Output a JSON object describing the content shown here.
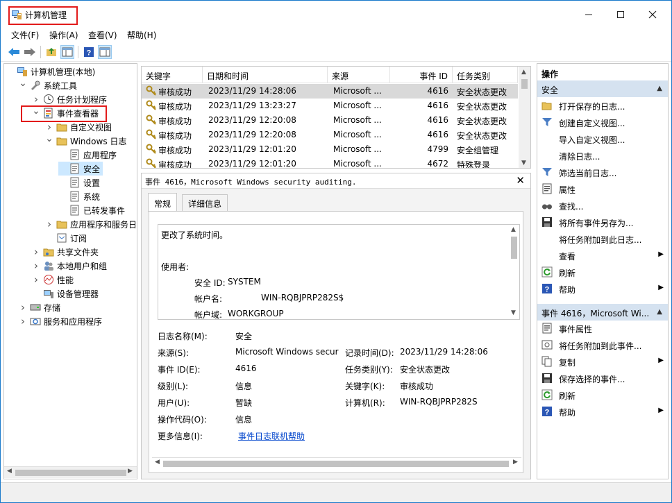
{
  "window": {
    "title": "计算机管理"
  },
  "menu": [
    "文件(F)",
    "操作(A)",
    "查看(V)",
    "帮助(H)"
  ],
  "tree": [
    {
      "label": "计算机管理(本地)",
      "level": 0,
      "chev": "",
      "icon": "computer-management-icon"
    },
    {
      "label": "系统工具",
      "level": 1,
      "chev": "v",
      "icon": "tools-icon"
    },
    {
      "label": "任务计划程序",
      "level": 2,
      "chev": ">",
      "icon": "clock-icon"
    },
    {
      "label": "事件查看器",
      "level": 2,
      "chev": "v",
      "icon": "event-viewer-icon"
    },
    {
      "label": "自定义视图",
      "level": 3,
      "chev": ">",
      "icon": "folder-icon"
    },
    {
      "label": "Windows 日志",
      "level": 3,
      "chev": "v",
      "icon": "folder-icon"
    },
    {
      "label": "应用程序",
      "level": 4,
      "chev": "",
      "icon": "log-icon"
    },
    {
      "label": "安全",
      "level": 4,
      "chev": "",
      "icon": "log-icon",
      "selected": true
    },
    {
      "label": "设置",
      "level": 4,
      "chev": "",
      "icon": "log-icon"
    },
    {
      "label": "系统",
      "level": 4,
      "chev": "",
      "icon": "log-icon"
    },
    {
      "label": "已转发事件",
      "level": 4,
      "chev": "",
      "icon": "log-icon"
    },
    {
      "label": "应用程序和服务日志",
      "level": 3,
      "chev": ">",
      "icon": "folder-icon"
    },
    {
      "label": "订阅",
      "level": 3,
      "chev": "",
      "icon": "subscription-icon"
    },
    {
      "label": "共享文件夹",
      "level": 2,
      "chev": ">",
      "icon": "shared-folder-icon"
    },
    {
      "label": "本地用户和组",
      "level": 2,
      "chev": ">",
      "icon": "users-icon"
    },
    {
      "label": "性能",
      "level": 2,
      "chev": ">",
      "icon": "performance-icon"
    },
    {
      "label": "设备管理器",
      "level": 2,
      "chev": "",
      "icon": "device-manager-icon"
    },
    {
      "label": "存储",
      "level": 1,
      "chev": ">",
      "icon": "storage-icon"
    },
    {
      "label": "服务和应用程序",
      "level": 1,
      "chev": ">",
      "icon": "services-icon"
    }
  ],
  "events": {
    "columns": [
      "关键字",
      "日期和时间",
      "来源",
      "事件 ID",
      "任务类别"
    ],
    "rows": [
      [
        "审核成功",
        "2023/11/29 14:28:06",
        "Microsoft ...",
        "4616",
        "安全状态更改"
      ],
      [
        "审核成功",
        "2023/11/29 13:23:27",
        "Microsoft ...",
        "4616",
        "安全状态更改"
      ],
      [
        "审核成功",
        "2023/11/29 12:20:08",
        "Microsoft ...",
        "4616",
        "安全状态更改"
      ],
      [
        "审核成功",
        "2023/11/29 12:20:08",
        "Microsoft ...",
        "4616",
        "安全状态更改"
      ],
      [
        "审核成功",
        "2023/11/29 12:01:20",
        "Microsoft ...",
        "4799",
        "安全组管理"
      ],
      [
        "审核成功",
        "2023/11/29 12:01:20",
        "Microsoft ...",
        "4672",
        "特殊登录"
      ]
    ]
  },
  "detail": {
    "title": "事件 4616，Microsoft Windows security auditing.",
    "tabs": [
      "常规",
      "详细信息"
    ],
    "message": {
      "line1": "更改了系统时间。",
      "line2": "使用者:",
      "sid_label": "安全 ID:",
      "sid_value": "SYSTEM",
      "acct_label": "帐户名:",
      "acct_value": "WIN-RQBJPRP282S$",
      "domain_label": "帐户域:",
      "domain_value": "WORKGROUP"
    },
    "fields": {
      "log_name_label": "日志名称(M):",
      "log_name": "安全",
      "source_label": "来源(S):",
      "source": "Microsoft Windows secur",
      "recorded_label": "记录时间(D):",
      "recorded": "2023/11/29 14:28:06",
      "event_id_label": "事件 ID(E):",
      "event_id": "4616",
      "task_label": "任务类别(Y):",
      "task": "安全状态更改",
      "level_label": "级别(L):",
      "level": "信息",
      "keywords_label": "关键字(K):",
      "keywords": "审核成功",
      "user_label": "用户(U):",
      "user": "暂缺",
      "computer_label": "计算机(R):",
      "computer": "WIN-RQBJPRP282S",
      "opcode_label": "操作代码(O):",
      "opcode": "信息",
      "more_label": "更多信息(I):",
      "more_link": "事件日志联机帮助"
    }
  },
  "actions": {
    "header": "操作",
    "section1": "安全",
    "items1": [
      {
        "label": "打开保存的日志...",
        "icon": "open-folder-icon",
        "sub": false
      },
      {
        "label": "创建自定义视图...",
        "icon": "filter-icon",
        "sub": false
      },
      {
        "label": "导入自定义视图...",
        "icon": "",
        "sub": false
      },
      {
        "label": "清除日志...",
        "icon": "",
        "sub": false
      },
      {
        "label": "筛选当前日志...",
        "icon": "filter-icon",
        "sub": false
      },
      {
        "label": "属性",
        "icon": "properties-icon",
        "sub": false
      },
      {
        "label": "查找...",
        "icon": "find-icon",
        "sub": false
      },
      {
        "label": "将所有事件另存为...",
        "icon": "save-icon",
        "sub": false
      },
      {
        "label": "将任务附加到此日志...",
        "icon": "",
        "sub": false
      },
      {
        "label": "查看",
        "icon": "",
        "sub": true
      },
      {
        "label": "刷新",
        "icon": "refresh-icon",
        "sub": false
      },
      {
        "label": "帮助",
        "icon": "help-icon",
        "sub": true
      }
    ],
    "section2": "事件 4616，Microsoft Wi...",
    "items2": [
      {
        "label": "事件属性",
        "icon": "properties-icon",
        "sub": false
      },
      {
        "label": "将任务附加到此事件...",
        "icon": "task-icon",
        "sub": false
      },
      {
        "label": "复制",
        "icon": "copy-icon",
        "sub": true
      },
      {
        "label": "保存选择的事件...",
        "icon": "save-icon",
        "sub": false
      },
      {
        "label": "刷新",
        "icon": "refresh-icon",
        "sub": false
      },
      {
        "label": "帮助",
        "icon": "help-icon",
        "sub": true
      }
    ]
  },
  "colors": {
    "selection": "#cce8ff",
    "section": "#d5e2f0",
    "highlight": "#e21b1b",
    "link": "#0044cc"
  }
}
